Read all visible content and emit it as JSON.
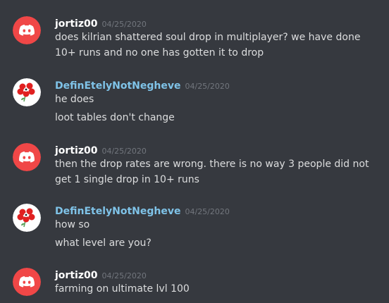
{
  "colors": {
    "background": "#36393f",
    "discord_red": "#f04747",
    "user1_name": "#ffffff",
    "user2_name": "#7fc3e8",
    "timestamp": "#72767d",
    "text": "#dcddde"
  },
  "messages": [
    {
      "author": "jortiz00",
      "timestamp": "04/25/2020",
      "avatar_icon": "discord-logo-icon",
      "lines": [
        "does kilrian shattered soul drop in multiplayer? we have done",
        "10+ runs and no one has gotten it to drop"
      ]
    },
    {
      "author": "DefinEtelyNotNegheve",
      "timestamp": "04/25/2020",
      "avatar_icon": "flower-avatar-icon",
      "lines": [
        "he does",
        "loot tables don't change"
      ]
    },
    {
      "author": "jortiz00",
      "timestamp": "04/25/2020",
      "avatar_icon": "discord-logo-icon",
      "lines": [
        "then the drop rates are wrong. there is no way 3 people did not",
        "get 1 single drop in 10+ runs"
      ]
    },
    {
      "author": "DefinEtelyNotNegheve",
      "timestamp": "04/25/2020",
      "avatar_icon": "flower-avatar-icon",
      "lines": [
        "how so",
        "what level are you?"
      ]
    },
    {
      "author": "jortiz00",
      "timestamp": "04/25/2020",
      "avatar_icon": "discord-logo-icon",
      "lines": [
        "farming on ultimate lvl 100"
      ]
    }
  ]
}
